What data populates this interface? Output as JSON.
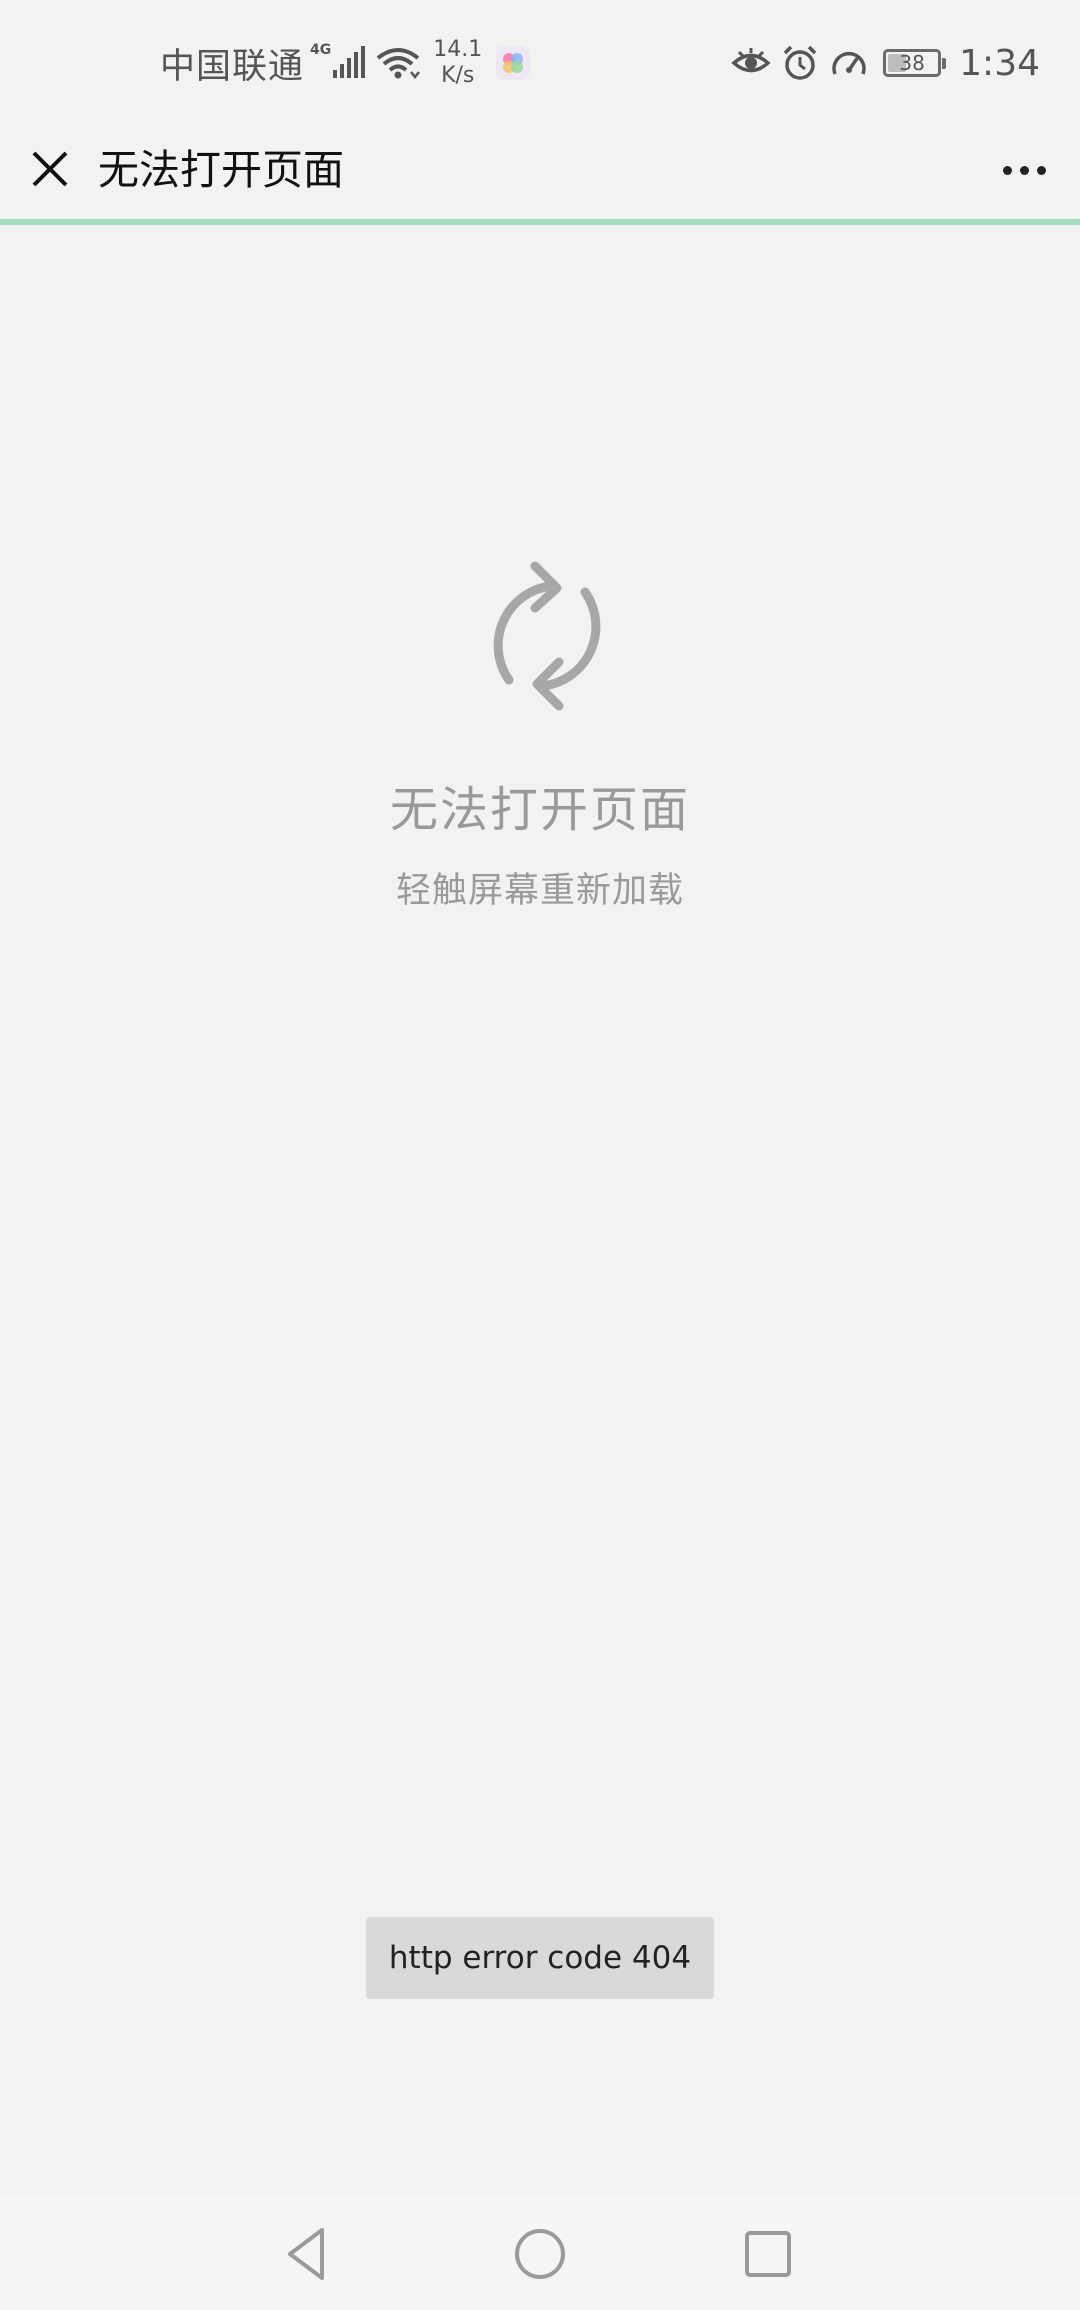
{
  "status_bar": {
    "carrier": "中国联通",
    "network_type": "4G",
    "speed_value": "14.1",
    "speed_unit": "K/s",
    "battery": "38",
    "time": "1:34"
  },
  "title_bar": {
    "title": "无法打开页面",
    "close_icon": "close-icon",
    "more_icon": "more-icon"
  },
  "progress": {
    "fraction": 1.0,
    "color": "#a8dcbf"
  },
  "error": {
    "icon": "reload-icon",
    "title": "无法打开页面",
    "subtitle": "轻触屏幕重新加载"
  },
  "toast": {
    "text": "http error code 404"
  },
  "nav_bar": {
    "back_icon": "back-triangle-icon",
    "home_icon": "home-circle-icon",
    "recents_icon": "recents-square-icon"
  },
  "colors": {
    "background": "#f2f2f2",
    "accent": "#a8dcbf",
    "muted_text": "#999999"
  }
}
